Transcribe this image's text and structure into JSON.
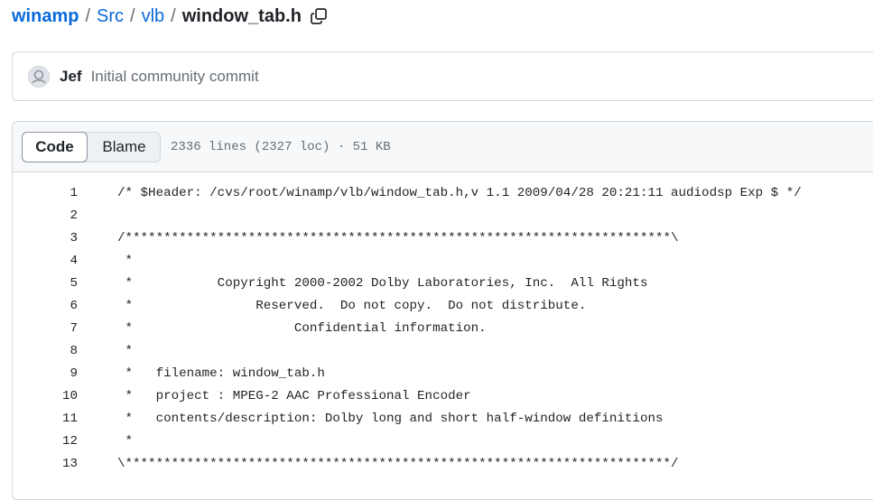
{
  "breadcrumb": {
    "repo": "winamp",
    "sep": "/",
    "path": [
      "Src",
      "vlb"
    ],
    "file": "window_tab.h",
    "copy_icon": "copy-icon"
  },
  "commit": {
    "avatar_icon": "user-avatar-icon",
    "author": "Jef",
    "message": "Initial community commit"
  },
  "file_view": {
    "tabs": [
      "Code",
      "Blame"
    ],
    "active_tab": "Code",
    "info": "2336 lines (2327 loc) · 51 KB"
  },
  "code_lines": [
    {
      "num": "1",
      "text": "/* $Header: /cvs/root/winamp/vlb/window_tab.h,v 1.1 2009/04/28 20:21:11 audiodsp Exp $ */"
    },
    {
      "num": "2",
      "text": ""
    },
    {
      "num": "3",
      "text": "/***********************************************************************\\"
    },
    {
      "num": "4",
      "text": " *"
    },
    {
      "num": "5",
      "text": " *           Copyright 2000-2002 Dolby Laboratories, Inc.  All Rights"
    },
    {
      "num": "6",
      "text": " *                Reserved.  Do not copy.  Do not distribute."
    },
    {
      "num": "7",
      "text": " *                     Confidential information."
    },
    {
      "num": "8",
      "text": " *"
    },
    {
      "num": "9",
      "text": " *   filename: window_tab.h"
    },
    {
      "num": "10",
      "text": " *   project : MPEG-2 AAC Professional Encoder"
    },
    {
      "num": "11",
      "text": " *   contents/description: Dolby long and short half-window definitions"
    },
    {
      "num": "12",
      "text": " *"
    },
    {
      "num": "13",
      "text": "\\***********************************************************************/"
    }
  ]
}
